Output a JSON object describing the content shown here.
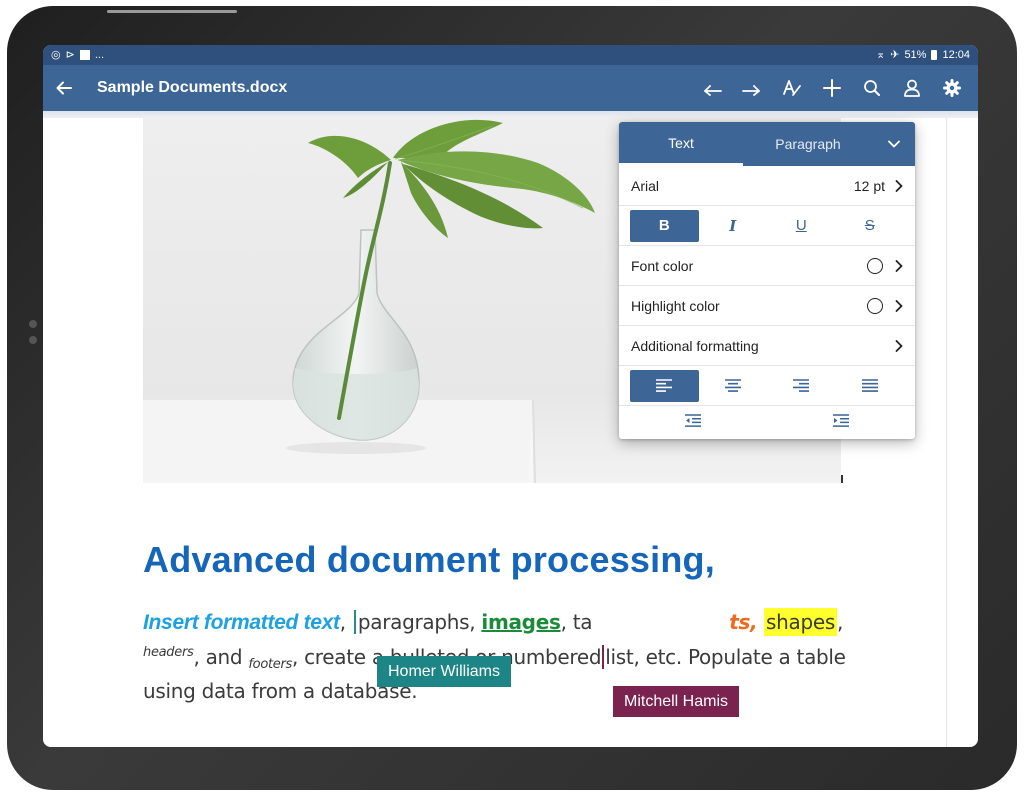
{
  "status_bar": {
    "left_icons": [
      "whatsapp-icon",
      "play-icon",
      "flipboard-icon"
    ],
    "more": "...",
    "battery": "51%",
    "time": "12:04"
  },
  "app_bar": {
    "title": "Sample Documents.docx",
    "tools": [
      "undo-icon",
      "redo-icon",
      "text-format-icon",
      "add-icon",
      "search-icon",
      "user-icon",
      "settings-icon"
    ]
  },
  "document": {
    "heading": "Advanced document processing,",
    "line1": {
      "blue": "Insert formatted text",
      "comma1": ",",
      "plain1": "paragraphs, ",
      "green": "images",
      "plain2": ", ta",
      "orange": "ts",
      "comma2": ", ",
      "yellow": "shapes",
      "comma3": ","
    },
    "line2": {
      "headers": "headers",
      "plain1": ", and ",
      "footers": "footers",
      "plain2": ", create a bulleted or numbered",
      "plain3": "list, etc. Populate a table"
    },
    "line3": "using data from a database."
  },
  "collaborators": {
    "homer": "Homer Williams",
    "mitchell": "Mitchell Hamis"
  },
  "format_panel": {
    "tab_text": "Text",
    "tab_paragraph": "Paragraph",
    "font_name": "Arial",
    "font_size": "12 pt",
    "styles": [
      "B",
      "I",
      "U",
      "S"
    ],
    "font_color_label": "Font color",
    "highlight_color_label": "Highlight color",
    "additional_label": "Additional formatting"
  },
  "colors": {
    "app_bar": "#3d6596",
    "status_bar": "#2f4f7d",
    "heading": "#1565b8",
    "homer_tag": "#1d8585",
    "mitchell_tag": "#7b2350",
    "highlight_yellow": "#ffff2e"
  }
}
